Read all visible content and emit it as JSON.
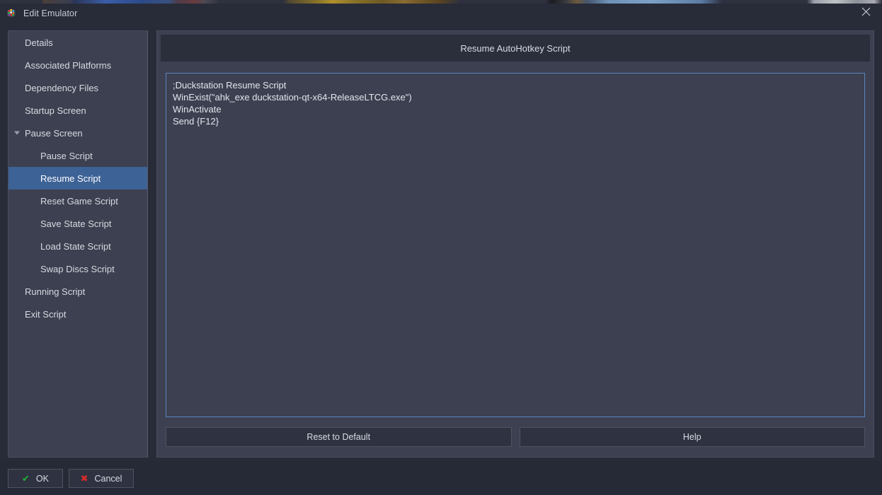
{
  "window": {
    "title": "Edit Emulator",
    "app_icon": "launchbox-cube-icon",
    "close_label": "✕"
  },
  "sidebar": {
    "items": [
      {
        "label": "Details",
        "level": 0,
        "selected": false,
        "expander": "none"
      },
      {
        "label": "Associated Platforms",
        "level": 0,
        "selected": false,
        "expander": "none"
      },
      {
        "label": "Dependency Files",
        "level": 0,
        "selected": false,
        "expander": "none"
      },
      {
        "label": "Startup Screen",
        "level": 0,
        "selected": false,
        "expander": "none"
      },
      {
        "label": "Pause Screen",
        "level": 0,
        "selected": false,
        "expander": "expanded"
      },
      {
        "label": "Pause Script",
        "level": 1,
        "selected": false,
        "expander": "none"
      },
      {
        "label": "Resume Script",
        "level": 1,
        "selected": true,
        "expander": "none"
      },
      {
        "label": "Reset Game Script",
        "level": 1,
        "selected": false,
        "expander": "none"
      },
      {
        "label": "Save State Script",
        "level": 1,
        "selected": false,
        "expander": "none"
      },
      {
        "label": "Load State Script",
        "level": 1,
        "selected": false,
        "expander": "none"
      },
      {
        "label": "Swap Discs Script",
        "level": 1,
        "selected": false,
        "expander": "none"
      },
      {
        "label": "Running Script",
        "level": 0,
        "selected": false,
        "expander": "none"
      },
      {
        "label": "Exit Script",
        "level": 0,
        "selected": false,
        "expander": "none"
      }
    ]
  },
  "main": {
    "header_title": "Resume AutoHotkey Script",
    "script_lines": [
      ";Duckstation Resume Script",
      "WinExist(\"ahk_exe duckstation-qt-x64-ReleaseLTCG.exe\")",
      "WinActivate",
      "Send {F12}"
    ],
    "reset_label": "Reset to Default",
    "help_label": "Help"
  },
  "footer": {
    "ok_label": "OK",
    "ok_glyph": "✔",
    "cancel_label": "Cancel",
    "cancel_glyph": "✖"
  },
  "colors": {
    "window_bg": "#282b38",
    "panel_bg": "#3c4050",
    "header_bg": "#2b2e3b",
    "selection_blue": "#3d6296",
    "textbox_border": "#5d82c0",
    "button_bg": "#2f3240",
    "footer_bg": "#262936",
    "text": "#d6dae2",
    "ok_green": "#25b33a",
    "cancel_red": "#d82b2b"
  }
}
